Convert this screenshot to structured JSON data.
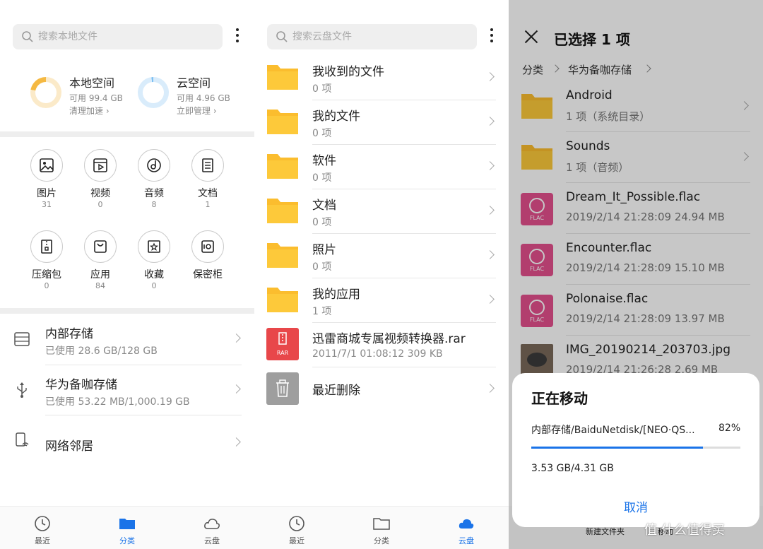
{
  "local_panel": {
    "search_placeholder": "搜索本地文件",
    "local_storage": {
      "title": "本地空间",
      "available": "可用 99.4 GB",
      "action": "清理加速",
      "used_fraction": 0.22,
      "ring_color": "#f5b942"
    },
    "cloud_storage": {
      "title": "云空间",
      "available": "可用 4.96 GB",
      "action": "立即管理",
      "used_fraction": 0.02,
      "ring_color": "#7ec0f2"
    },
    "categories": [
      {
        "label": "图片",
        "count": "31",
        "icon": "image-icon"
      },
      {
        "label": "视频",
        "count": "0",
        "icon": "video-icon"
      },
      {
        "label": "音频",
        "count": "8",
        "icon": "audio-icon"
      },
      {
        "label": "文档",
        "count": "1",
        "icon": "document-icon"
      },
      {
        "label": "压缩包",
        "count": "0",
        "icon": "archive-icon"
      },
      {
        "label": "应用",
        "count": "84",
        "icon": "app-icon"
      },
      {
        "label": "收藏",
        "count": "0",
        "icon": "favorite-icon"
      },
      {
        "label": "保密柜",
        "count": "",
        "icon": "safe-icon"
      }
    ],
    "storages": [
      {
        "title": "内部存储",
        "subtitle": "已使用 28.6 GB/128 GB",
        "icon": "storage-icon"
      },
      {
        "title": "华为备咖存储",
        "subtitle": "已使用 53.22 MB/1,000.19 GB",
        "icon": "usb-icon"
      },
      {
        "title": "网络邻居",
        "subtitle": "",
        "icon": "network-neighbor-icon"
      }
    ],
    "nav": {
      "recent": "最近",
      "category": "分类",
      "cloud": "云盘"
    }
  },
  "cloud_panel": {
    "search_placeholder": "搜索云盘文件",
    "items": [
      {
        "title": "我收到的文件",
        "subtitle": "0 项"
      },
      {
        "title": "我的文件",
        "subtitle": "0 项"
      },
      {
        "title": "软件",
        "subtitle": "0 项"
      },
      {
        "title": "文档",
        "subtitle": "0 项"
      },
      {
        "title": "照片",
        "subtitle": "0 项"
      },
      {
        "title": "我的应用",
        "subtitle": "1 项"
      },
      {
        "title": "迅雷商城专属视频转换器.rar",
        "subtitle": "2011/7/1 01:08:12 309 KB",
        "file_label": "RAR"
      },
      {
        "title": "最近删除",
        "subtitle": ""
      }
    ],
    "nav": {
      "recent": "最近",
      "category": "分类",
      "cloud": "云盘"
    }
  },
  "move_panel": {
    "header_title": "已选择 1 项",
    "breadcrumb": [
      "分类",
      "华为备咖存储"
    ],
    "items": [
      {
        "title": "Android",
        "subtitle": "1 项（系统目录）",
        "type": "folder"
      },
      {
        "title": "Sounds",
        "subtitle": "1 项（音频）",
        "type": "folder"
      },
      {
        "title": "Dream_It_Possible.flac",
        "subtitle": "2019/2/14 21:28:09 24.94 MB",
        "type": "flac",
        "file_label": "FLAC"
      },
      {
        "title": "Encounter.flac",
        "subtitle": "2019/2/14 21:28:09 15.10 MB",
        "type": "flac",
        "file_label": "FLAC"
      },
      {
        "title": "Polonaise.flac",
        "subtitle": "2019/2/14 21:28:09 13.97 MB",
        "type": "flac",
        "file_label": "FLAC"
      },
      {
        "title": "IMG_20190214_203703.jpg",
        "subtitle": "2019/2/14 21:26:28 2.69 MB",
        "type": "image"
      }
    ],
    "bottom": {
      "new_folder": "新建文件夹",
      "move": "移动"
    },
    "dialog": {
      "title": "正在移动",
      "path": "内部存储/BaiduNetdisk/[NEO·QS...",
      "percent": "82%",
      "progress": 0.82,
      "size": "3.53 GB/4.31 GB",
      "cancel": "取消"
    }
  },
  "watermark": "值 什么值得买",
  "colors": {
    "accent": "#1a73e8",
    "folder": "#fbbd2e",
    "flac": "#e5508e"
  }
}
